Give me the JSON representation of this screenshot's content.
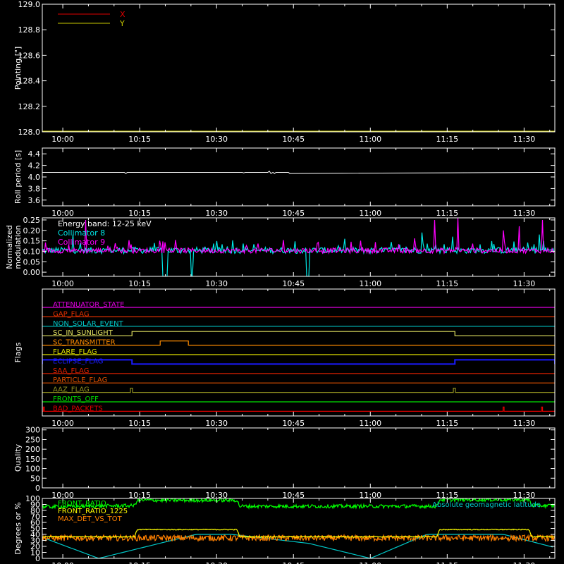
{
  "time_axis": {
    "tick_labels": [
      "10:00",
      "10:15",
      "10:30",
      "10:45",
      "11:00",
      "11:15",
      "11:30"
    ],
    "tick_minutes": [
      0,
      15,
      30,
      45,
      60,
      75,
      90
    ],
    "range_minutes": [
      -4,
      96
    ]
  },
  "chart_data": [
    {
      "type": "line",
      "panel": "pointing",
      "ylabel": "Pointing [\"]",
      "ylim": [
        128.0,
        129.0
      ],
      "yticks": [
        128.0,
        128.2,
        128.4,
        128.6,
        128.8,
        129.0
      ],
      "ytick_labels": [
        "128.0",
        "128.2",
        "128.4",
        "128.6",
        "128.8",
        "129.0"
      ],
      "legend_placement": "top-left",
      "series": [
        {
          "name": "X",
          "color": "#e00000",
          "x": [
            -4,
            96
          ],
          "y": [
            128.0,
            128.0
          ]
        },
        {
          "name": "Y",
          "color": "#c8c800",
          "x": [
            -4,
            96
          ],
          "y": [
            128.0,
            128.0
          ]
        }
      ]
    },
    {
      "type": "line",
      "panel": "roll",
      "ylabel": "Roll period [s]",
      "ylim": [
        3.5,
        4.5
      ],
      "yticks": [
        3.6,
        3.8,
        4.0,
        4.2,
        4.4
      ],
      "ytick_labels": [
        "3.6",
        "3.8",
        "4.0",
        "4.2",
        "4.4"
      ],
      "series": [
        {
          "color": "#ffffff",
          "x": [
            -4,
            12,
            12.3,
            12.6,
            35,
            35.3,
            35.6,
            40,
            40.3,
            40.6,
            41,
            41.3,
            41.6,
            44,
            44.3,
            96
          ],
          "y": [
            4.08,
            4.08,
            4.06,
            4.08,
            4.08,
            4.07,
            4.08,
            4.08,
            4.1,
            4.06,
            4.08,
            4.06,
            4.08,
            4.08,
            4.06,
            4.08
          ]
        }
      ]
    },
    {
      "type": "line",
      "panel": "modulation",
      "ylabel": "Normalized modulation",
      "ylim": [
        -0.02,
        0.26
      ],
      "yticks": [
        0.0,
        0.05,
        0.1,
        0.15,
        0.2,
        0.25
      ],
      "ytick_labels": [
        "0.00",
        "0.05",
        "0.10",
        "0.15",
        "0.20",
        "0.25"
      ],
      "annotation": "Energy band: 12-25 keV",
      "series": [
        {
          "name": "Collimator 8",
          "color": "#00e8e8",
          "baseline": 0.1,
          "noise": 0.03,
          "dropouts": [
            [
              19.5,
              20.5
            ],
            [
              25,
              25.5
            ],
            [
              47.5,
              48
            ]
          ],
          "spikes": [
            {
              "x": 2,
              "y": 0.18
            },
            {
              "x": 70,
              "y": 0.19
            },
            {
              "x": 84,
              "y": 0.21
            },
            {
              "x": 93,
              "y": 0.18
            },
            {
              "x": 76,
              "y": 0.17
            },
            {
              "x": 55,
              "y": 0.16
            }
          ]
        },
        {
          "name": "Collimator 9",
          "color": "#ff00ff",
          "baseline": 0.1,
          "noise": 0.025,
          "spikes": [
            {
              "x": 4.5,
              "y": 0.25
            },
            {
              "x": 72.5,
              "y": 0.25
            },
            {
              "x": 77,
              "y": 0.26
            },
            {
              "x": 89,
              "y": 0.22
            },
            {
              "x": 93.5,
              "y": 0.25
            },
            {
              "x": 86,
              "y": 0.2
            }
          ]
        }
      ]
    },
    {
      "type": "line",
      "panel": "flags",
      "ylabel": "Flags",
      "flags": [
        {
          "name": "ATTENUATOR_STATE",
          "color": "#e000e0",
          "high": []
        },
        {
          "name": "GAP_FLAG",
          "color": "#e03000",
          "high": []
        },
        {
          "name": "NON_SOLAR_EVENT",
          "color": "#00c8c8",
          "high": []
        },
        {
          "name": "SC_IN_SUNLIGHT",
          "color": "#e0e060",
          "high": [
            [
              13.5,
              76.5
            ]
          ]
        },
        {
          "name": "SC_TRANSMITTER",
          "color": "#ff8c00",
          "high": [
            [
              19,
              24.5
            ]
          ]
        },
        {
          "name": "FLARE_FLAG",
          "color": "#e0e000",
          "high": []
        },
        {
          "name": "ECLIPSE_FLAG",
          "color": "#1a1aff",
          "high": [
            [
              -4,
              13.5
            ],
            [
              76.5,
              96
            ]
          ]
        },
        {
          "name": "SAA_FLAG",
          "color": "#e02000",
          "high": []
        },
        {
          "name": "PARTICLE_FLAG",
          "color": "#e05000",
          "high": []
        },
        {
          "name": "AAZ_FLAG",
          "color": "#909020",
          "high": [
            [
              13.2,
              13.6
            ],
            [
              76.2,
              76.6
            ]
          ]
        },
        {
          "name": "FRONTS_OFF",
          "color": "#00e000",
          "high": []
        },
        {
          "name": "BAD_PACKETS",
          "color": "#e00000",
          "high": [
            [
              -3.8,
              -3.6
            ],
            [
              85.9,
              86.1
            ],
            [
              93.4,
              93.6
            ]
          ]
        }
      ]
    },
    {
      "type": "line",
      "panel": "quality",
      "ylabel": "Quality",
      "ylim": [
        0,
        310
      ],
      "yticks": [
        0,
        50,
        100,
        150,
        200,
        250,
        300
      ],
      "ytick_labels": [
        "0",
        "50",
        "100",
        "150",
        "200",
        "250",
        "300"
      ],
      "series": []
    },
    {
      "type": "line",
      "panel": "ratios",
      "ylabel": "Degrees or %",
      "ylim": [
        0,
        100
      ],
      "yticks": [
        0,
        10,
        20,
        30,
        40,
        50,
        60,
        70,
        80,
        90,
        100
      ],
      "ytick_labels": [
        "0",
        "10",
        "20",
        "30",
        "40",
        "50",
        "60",
        "70",
        "80",
        "90",
        "100"
      ],
      "series": [
        {
          "name": "FRONT_RATIO",
          "color": "#00ff00",
          "noise": 3,
          "x": [
            -4,
            14,
            14.5,
            34,
            34.5,
            73,
            73.5,
            91,
            91.5,
            96
          ],
          "y": [
            86,
            88,
            97,
            97,
            87,
            87,
            98,
            98,
            88,
            88
          ]
        },
        {
          "name": "FRONT_RATIO_1225",
          "color": "#ffff00",
          "noise": 0.8,
          "x": [
            -4,
            14,
            14.5,
            34,
            34.5,
            73,
            73.5,
            91,
            91.5,
            96
          ],
          "y": [
            36,
            36,
            48,
            48,
            36,
            36,
            48,
            48,
            36,
            36
          ]
        },
        {
          "name": "MAX_DET_VS_TOT",
          "color": "#ff8000",
          "noise": 5,
          "x": [
            -4,
            96
          ],
          "y": [
            34,
            34
          ]
        },
        {
          "name": "Absolute geomagnetic latitude",
          "color": "#00c8c8",
          "noise": 0,
          "x": [
            -4,
            7,
            26,
            33,
            48,
            60,
            71,
            86,
            96
          ],
          "y": [
            35,
            0,
            40,
            40,
            25,
            0,
            40,
            40,
            18
          ]
        }
      ]
    }
  ]
}
